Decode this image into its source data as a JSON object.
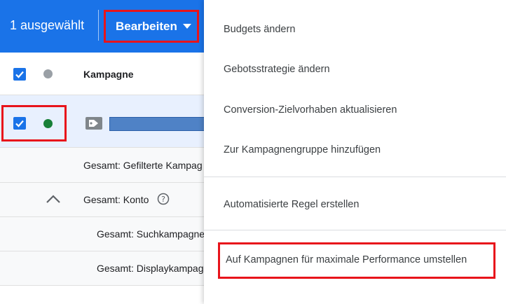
{
  "toolbar": {
    "selected_count": "1 ausgewählt",
    "edit_label": "Bearbeiten",
    "background_color": "#1a73e8"
  },
  "table": {
    "header": {
      "column_label": "Kampagne"
    },
    "rows": [
      {
        "label": "Gesamt: Gefilterte Kampag"
      },
      {
        "label": "Gesamt: Konto"
      },
      {
        "label": "Gesamt: Suchkampagne"
      },
      {
        "label": "Gesamt: Displaykampag"
      }
    ],
    "status_color_active": "#188038",
    "status_color_header": "#9aa0a6"
  },
  "menu": {
    "items": [
      {
        "label": "Budgets ändern"
      },
      {
        "label": "Gebotsstrategie ändern"
      },
      {
        "label": "Conversion-Zielvorhaben aktualisieren"
      },
      {
        "label": "Zur Kampagnengruppe hinzufügen"
      },
      {
        "label": "Automatisierte Regel erstellen"
      },
      {
        "label": "Auf Kampagnen für maximale Performance umstellen"
      }
    ],
    "highlight_color": "#e8141b"
  }
}
